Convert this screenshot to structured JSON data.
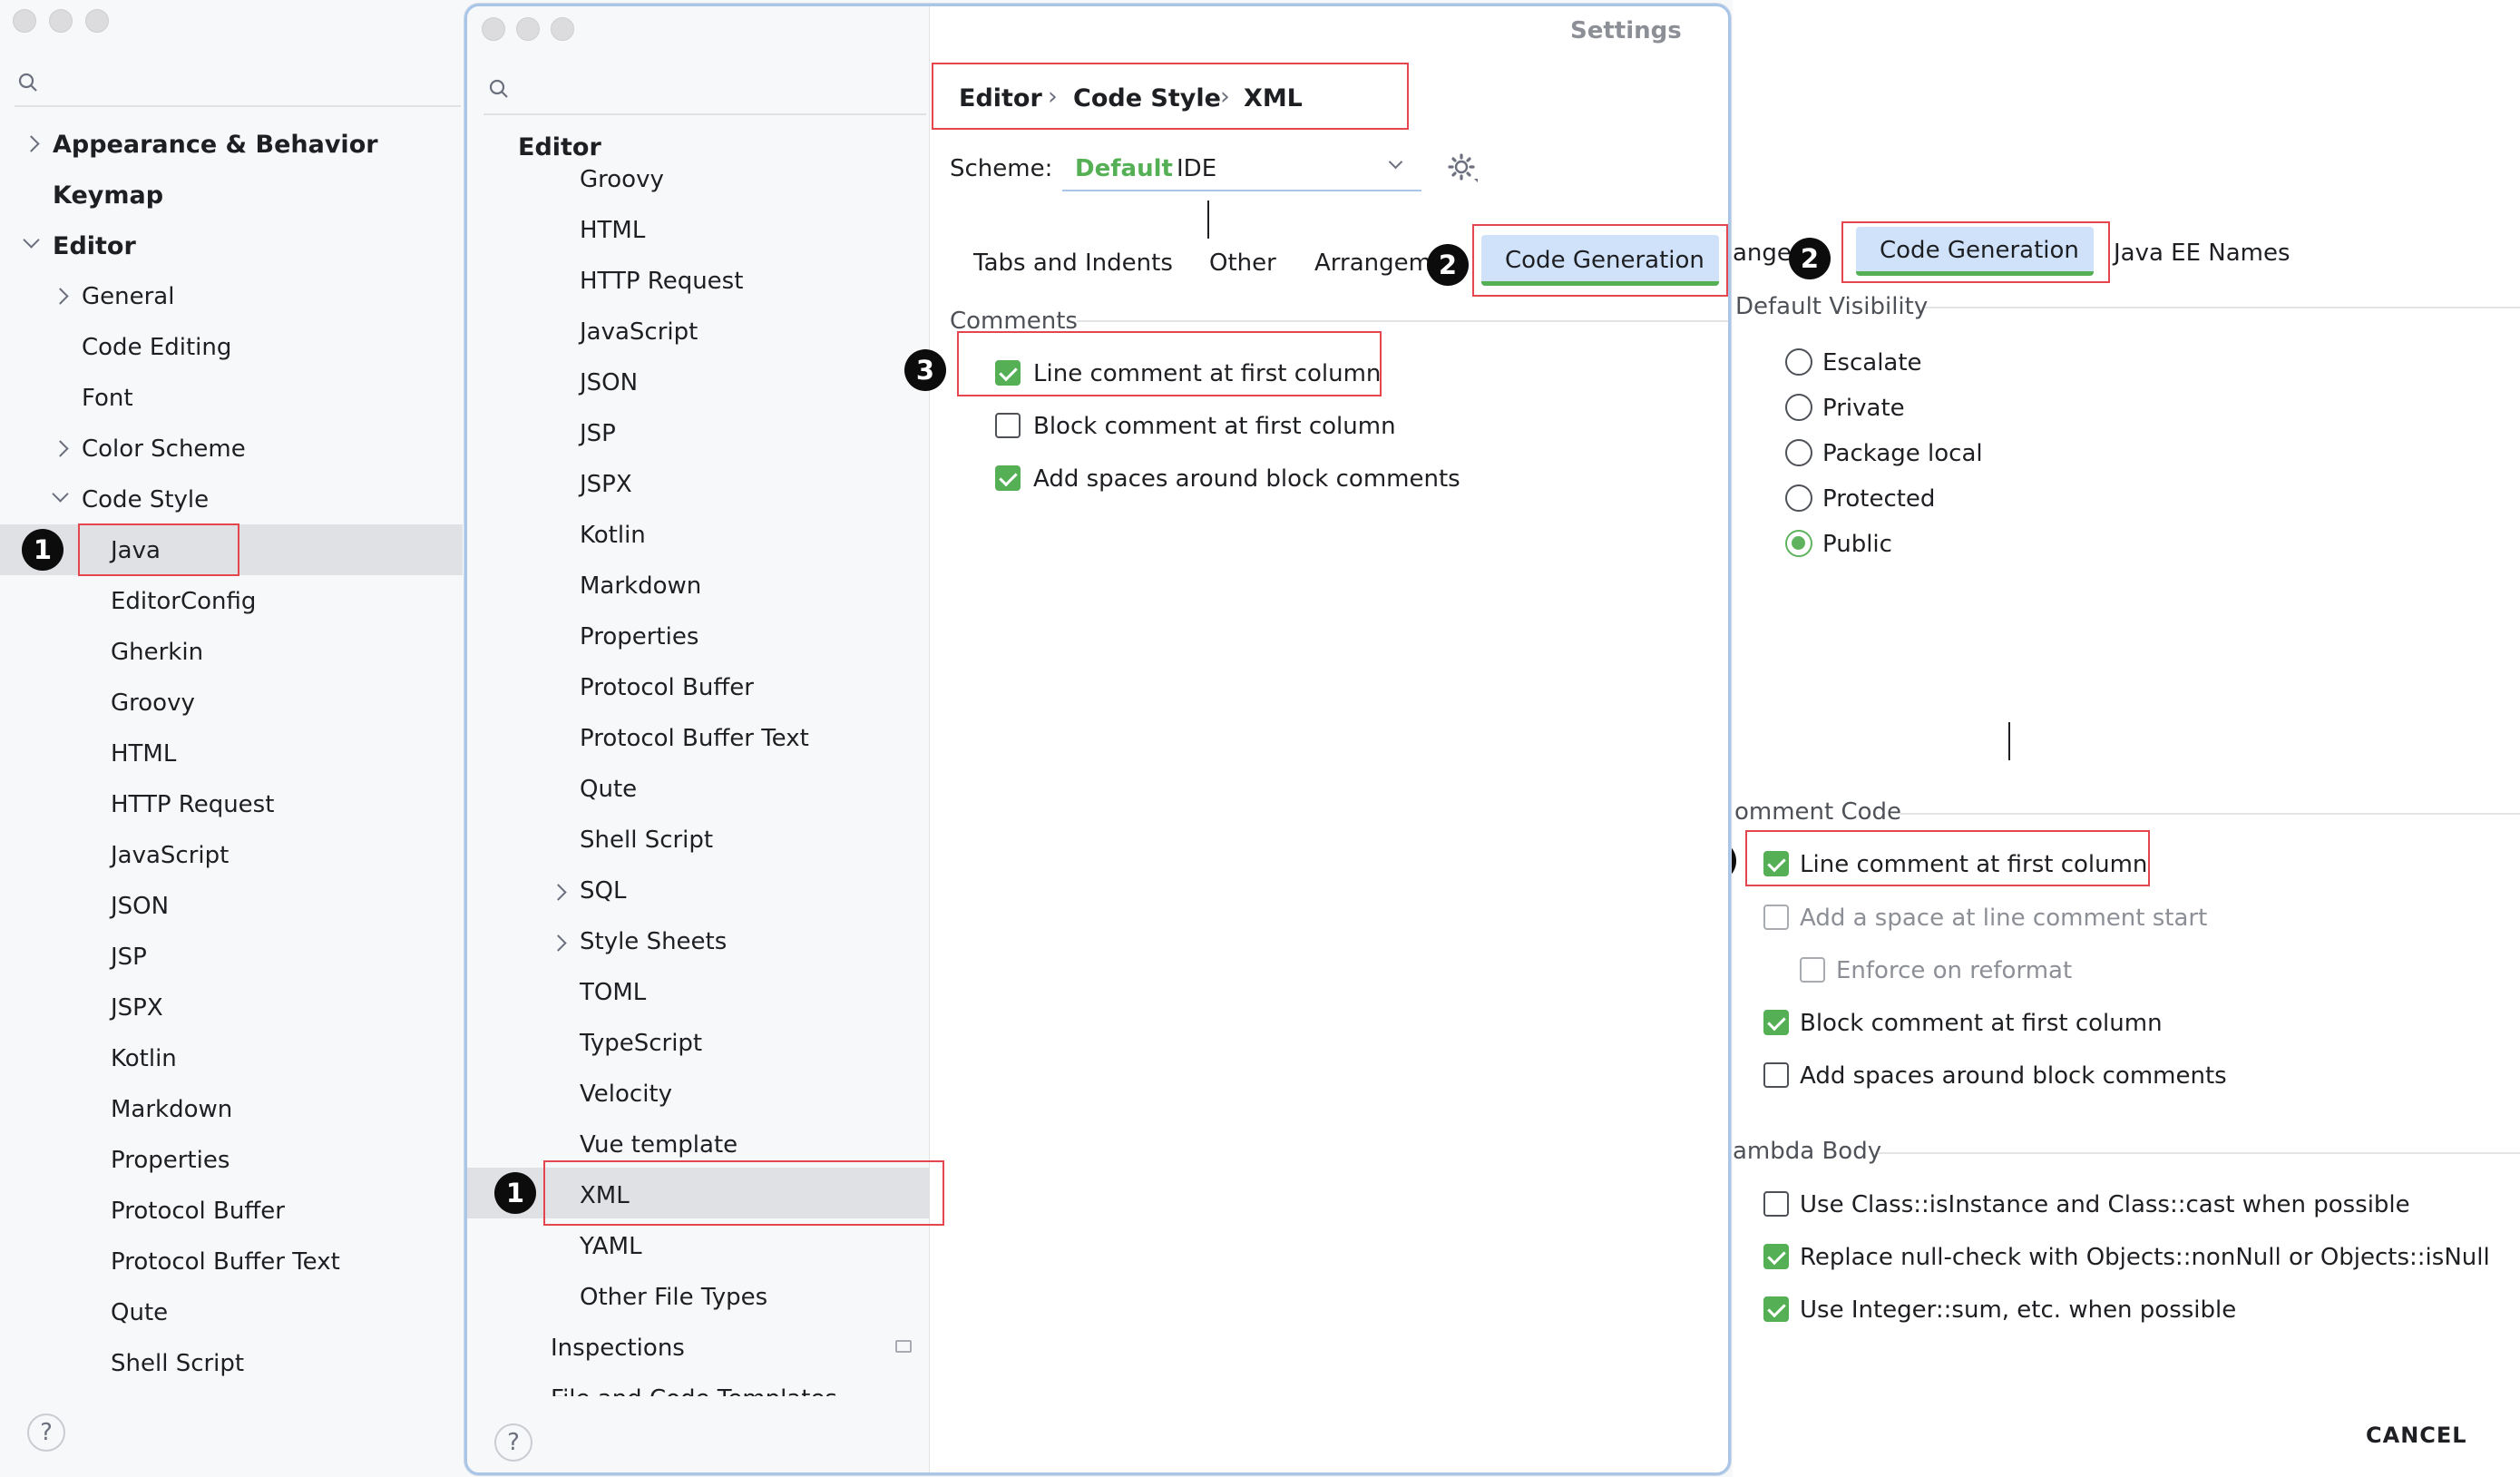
{
  "window_title": "Settings",
  "search": {
    "placeholder": ""
  },
  "left_tree": {
    "top_items": [
      {
        "label": "Appearance & Behavior"
      },
      {
        "label": "Keymap"
      },
      {
        "label": "Editor"
      }
    ],
    "editor_children": [
      {
        "label": "General"
      },
      {
        "label": "Code Editing"
      },
      {
        "label": "Font"
      },
      {
        "label": "Color Scheme"
      },
      {
        "label": "Code Style"
      }
    ],
    "code_style_children": [
      "Java",
      "EditorConfig",
      "Gherkin",
      "Groovy",
      "HTML",
      "HTTP Request",
      "JavaScript",
      "JSON",
      "JSP",
      "JSPX",
      "Kotlin",
      "Markdown",
      "Properties",
      "Protocol Buffer",
      "Protocol Buffer Text",
      "Qute",
      "Shell Script"
    ]
  },
  "mid_tree": {
    "header": "Editor",
    "items": [
      "Groovy",
      "HTML",
      "HTTP Request",
      "JavaScript",
      "JSON",
      "JSP",
      "JSPX",
      "Kotlin",
      "Markdown",
      "Properties",
      "Protocol Buffer",
      "Protocol Buffer Text",
      "Qute",
      "Shell Script",
      "SQL",
      "Style Sheets",
      "TOML",
      "TypeScript",
      "Velocity",
      "Vue template",
      "XML",
      "YAML",
      "Other File Types"
    ],
    "inspections": "Inspections",
    "file_templates": "File and Code Templates"
  },
  "breadcrumb": {
    "part1": "Editor",
    "sep": "›",
    "part2": "Code Style",
    "part3": "XML"
  },
  "scheme": {
    "label": "Scheme:",
    "name": "Default",
    "suffix": "IDE"
  },
  "xml_tabs": {
    "tab1": "Tabs and Indents",
    "tab2": "Other",
    "tab3": "Arrangeme",
    "tab4": "Code Generation"
  },
  "xml_comments": {
    "section": "Comments",
    "opt1": "Line comment at first column",
    "opt2": "Block comment at first column",
    "opt3": "Add spaces around block comments"
  },
  "java_tabs": {
    "tab_prefix": "angem",
    "tab_active": "Code Generation",
    "tab_next": "Java EE Names"
  },
  "default_visibility": {
    "section": "Default Visibility",
    "options": [
      "Escalate",
      "Private",
      "Package local",
      "Protected",
      "Public"
    ],
    "selected": "Public"
  },
  "comment_code": {
    "section": "omment Code",
    "opt1": "Line comment at first column",
    "opt2": "Add a space at line comment start",
    "opt3": "Enforce on reformat",
    "opt4": "Block comment at first column",
    "opt5": "Add spaces around block comments"
  },
  "lambda_body": {
    "section": "ambda Body",
    "opt1": "Use Class::isInstance and Class::cast when possible",
    "opt2": "Replace null-check with Objects::nonNull or Objects::isNull",
    "opt3": "Use Integer::sum, etc. when possible"
  },
  "footer": {
    "cancel": "CANCEL",
    "help": "?"
  },
  "badges": {
    "one": "1",
    "two": "2",
    "three": "3"
  },
  "colors": {
    "accent_green": "#55b055",
    "highlight_red": "#e5454c",
    "tab_blue": "#cfe2fa"
  }
}
